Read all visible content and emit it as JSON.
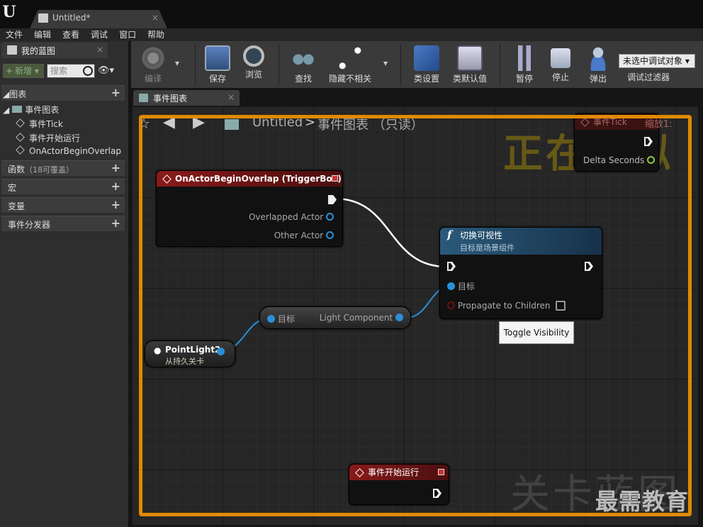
{
  "window": {
    "tab_title": "Untitled*",
    "close_glyph": "×"
  },
  "menu": [
    "文件",
    "编辑",
    "查看",
    "调试",
    "窗口",
    "帮助"
  ],
  "left_panel": {
    "tab_label": "我的蓝图",
    "new_label": "新增",
    "search_placeholder": "搜索",
    "sections": {
      "graphs": "图表",
      "functions": "函数",
      "functions_note": "（18可覆盖）",
      "macros": "宏",
      "variables": "变量",
      "dispatchers": "事件分发器"
    },
    "event_graph": "事件图表",
    "events": [
      "事件Tick",
      "事件开始运行",
      "OnActorBeginOverlap"
    ]
  },
  "toolbar": {
    "compile": "编译",
    "save": "保存",
    "browse": "浏览",
    "find": "查找",
    "hide_unrelated": "隐藏不相关",
    "class_settings": "类设置",
    "class_defaults": "类默认值",
    "pause": "暂停",
    "stop": "停止",
    "eject": "弹出",
    "debug_object": "未选中调试对象",
    "debug_filter": "调试过滤器"
  },
  "graph_tab": "事件图表",
  "breadcrumb": {
    "root": "Untitled",
    "sep": ">",
    "current": "事件图表",
    "readonly": "（只读）"
  },
  "overlays": {
    "simulating": "正在模拟",
    "level_blueprint": "关卡蓝图",
    "watermark": "最需教育",
    "zoom": "缩放1:"
  },
  "nodes": {
    "overlap": {
      "title": "OnActorBeginOverlap (TriggerBox)",
      "pins": [
        "Overlapped Actor",
        "Other Actor"
      ]
    },
    "tick": {
      "title": "事件Tick",
      "pin": "Delta Seconds"
    },
    "toggle": {
      "title": "切换可视性",
      "subtitle": "目标是场景组件",
      "target": "目标",
      "propagate": "Propagate to Children"
    },
    "getter": {
      "target": "目标",
      "output": "Light Component"
    },
    "pointlight": {
      "title": "PointLight2",
      "subtitle": "从持久关卡"
    },
    "beginplay": {
      "title": "事件开始运行"
    }
  },
  "tooltip": "Toggle Visibility",
  "colors": {
    "event_header": "#8a1a1a",
    "function_header": "#2a5a7a",
    "object_pin": "#2b8fd8",
    "sim_border": "#e08a00"
  }
}
